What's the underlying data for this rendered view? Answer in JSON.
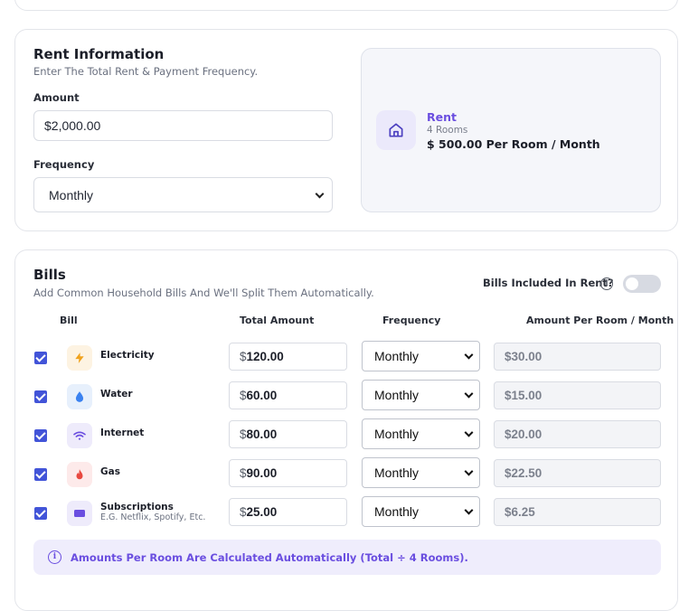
{
  "rent": {
    "title": "Rent Information",
    "subtitle": "Enter The Total Rent & Payment Frequency.",
    "amount_label": "Amount",
    "amount_value": "$2,000.00",
    "frequency_label": "Frequency",
    "frequency_value": "Monthly",
    "preview": {
      "icon": "house-icon",
      "title": "Rent",
      "rooms": "4 Rooms",
      "per_room": "$ 500.00 Per Room / Month"
    }
  },
  "bills": {
    "title": "Bills",
    "subtitle": "Add Common Household Bills And We'll Split Them Automatically.",
    "toggle_label": "Bills Included In Rent?",
    "toggle_on": false,
    "headers": {
      "bill": "Bill",
      "total": "Total Amount",
      "frequency": "Frequency",
      "per_room": "Amount Per Room / Month"
    },
    "rows": [
      {
        "name": "Electricity",
        "note": "",
        "icon": "lightning-icon",
        "checked": true,
        "currency": "$",
        "amount": "120.00",
        "frequency": "Monthly",
        "per_room": "$30.00"
      },
      {
        "name": "Water",
        "note": "",
        "icon": "water-drop-icon",
        "checked": true,
        "currency": "$",
        "amount": "60.00",
        "frequency": "Monthly",
        "per_room": "$15.00"
      },
      {
        "name": "Internet",
        "note": "",
        "icon": "wifi-icon",
        "checked": true,
        "currency": "$",
        "amount": "80.00",
        "frequency": "Monthly",
        "per_room": "$20.00"
      },
      {
        "name": "Gas",
        "note": "",
        "icon": "flame-icon",
        "checked": true,
        "currency": "$",
        "amount": "90.00",
        "frequency": "Monthly",
        "per_room": "$22.50"
      },
      {
        "name": "Subscriptions",
        "note": "E.G. Netflix, Spotify, Etc.",
        "icon": "subscription-icon",
        "checked": true,
        "currency": "$",
        "amount": "25.00",
        "frequency": "Monthly",
        "per_room": "$6.25"
      }
    ],
    "note": "Amounts Per Room Are Calculated Automatically (Total ÷ 4 Rooms)."
  },
  "colors": {
    "accent": "#6a4ee0",
    "checkbox": "#4254d8"
  }
}
